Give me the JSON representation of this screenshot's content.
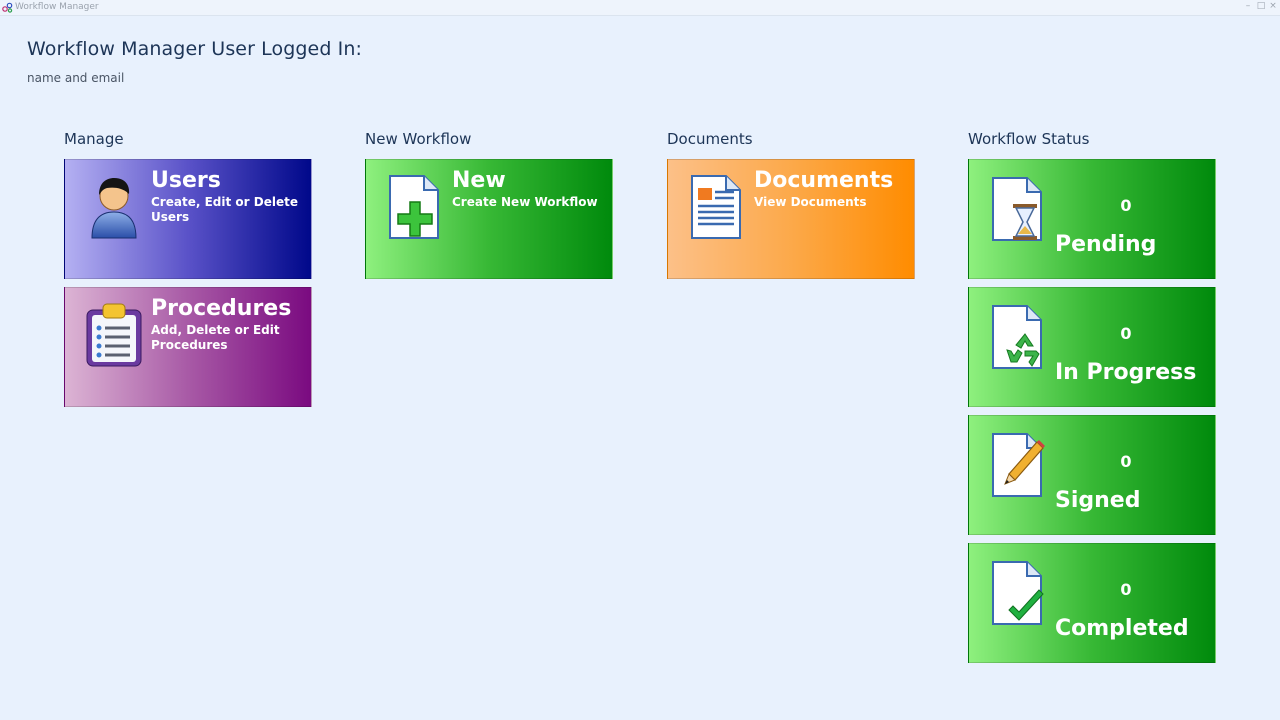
{
  "window": {
    "title": "Workflow Manager",
    "controls": {
      "minimize": "–",
      "maximize": "□",
      "close": "×"
    }
  },
  "header": {
    "title": "Workflow Manager User Logged In:",
    "subtitle": "name and email"
  },
  "columns": {
    "manage": {
      "heading": "Manage",
      "tiles": [
        {
          "title": "Users",
          "description": "Create, Edit or Delete Users",
          "icon": "user-icon"
        },
        {
          "title": "Procedures",
          "description": "Add, Delete or Edit Procedures",
          "icon": "clipboard-icon"
        }
      ]
    },
    "new_workflow": {
      "heading": "New Workflow",
      "tiles": [
        {
          "title": "New",
          "description": "Create New Workflow",
          "icon": "new-document-icon"
        }
      ]
    },
    "documents": {
      "heading": "Documents",
      "tiles": [
        {
          "title": "Documents",
          "description": "View Documents",
          "icon": "document-icon"
        }
      ]
    },
    "status": {
      "heading": "Workflow Status",
      "tiles": [
        {
          "count": "0",
          "label": "Pending",
          "icon": "hourglass-document-icon"
        },
        {
          "count": "0",
          "label": "In Progress",
          "icon": "recycle-document-icon"
        },
        {
          "count": "0",
          "label": "Signed",
          "icon": "pencil-document-icon"
        },
        {
          "count": "0",
          "label": "Completed",
          "icon": "check-document-icon"
        }
      ]
    }
  },
  "colors": {
    "background": "#e8f1fd",
    "users_tile": "#00088a",
    "procedures_tile": "#7a0a80",
    "green_tile": "#008a0c",
    "documents_tile": "#ff8c00",
    "text_heading": "#1d3557"
  }
}
